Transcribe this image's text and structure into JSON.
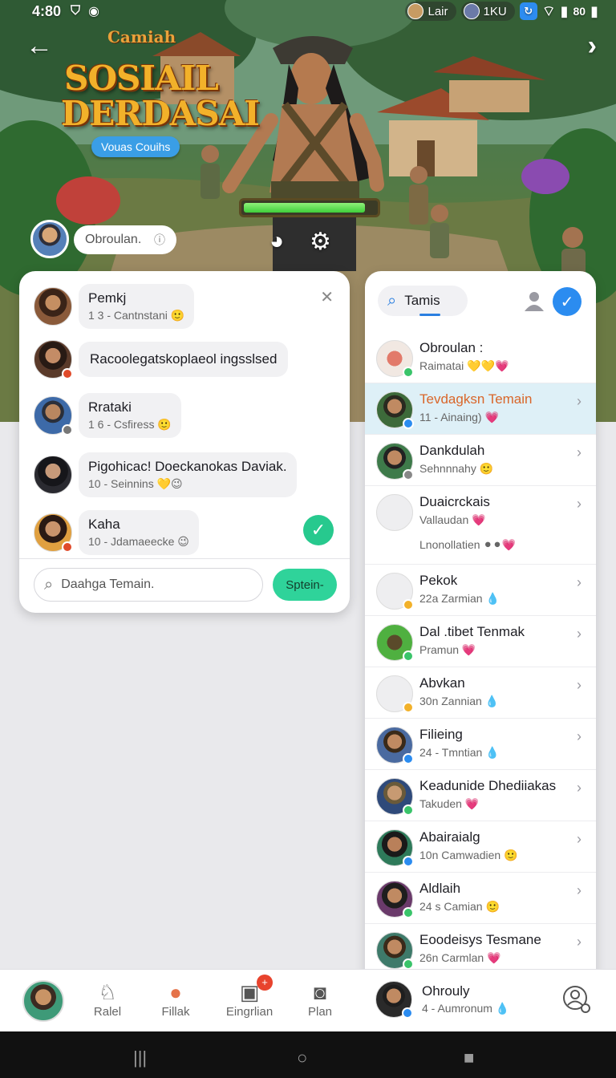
{
  "status_bar": {
    "time": "4:80",
    "chip1": "Lair",
    "chip2": "1KU",
    "battery": "80"
  },
  "game": {
    "subtitle": "Camiah",
    "title": "SOSIAIL DERDASAI",
    "tag": "Vouas Couihs",
    "health_fraction": 0.92
  },
  "profile": {
    "name": "Obroulan."
  },
  "chat_panel": {
    "messages": [
      {
        "name": "Pemkj",
        "sub": "1 3 - Cantnstani 🙂"
      },
      {
        "name": "Racoolegatskoplaeol ingsslsed",
        "sub": ""
      },
      {
        "name": "Rrataki",
        "sub": "1 6 - Csfiress 🙂"
      },
      {
        "name": "Pigohicac! Doeckanokas Daviak.",
        "sub": "10 - Seinnins 💛😉"
      },
      {
        "name": "Kaha",
        "sub": "10 - Jdamaeecke 😉"
      }
    ],
    "search_placeholder": "Daahga Temain.",
    "send_label": "Sptein-"
  },
  "friends_panel": {
    "tab_label": "Tamis",
    "friends": [
      {
        "name": "Obroulan :",
        "sub": "Raimatai 💛💛💗"
      },
      {
        "name": "Tevdagksn Temain",
        "sub": "11 - Ainaing) 💗"
      },
      {
        "name": "Dankdulah",
        "sub": "Sehnnnahy 🙂"
      },
      {
        "name": "Duaicrckais",
        "sub": "Vallaudan 💗",
        "sub2": "Lnonollatien ⚫⚫💗"
      },
      {
        "name": "Pekok",
        "sub": "22a Zarmian 💧"
      },
      {
        "name": "Dal .tibet Tenmak",
        "sub": "Pramun 💗"
      },
      {
        "name": "Abvkan",
        "sub": "30n Zannian 💧"
      },
      {
        "name": "Filieing",
        "sub": "24 - Tmntian 💧"
      },
      {
        "name": "Keadunide Dhediiakas",
        "sub": "Takuden 💗"
      },
      {
        "name": "Abairaialg",
        "sub": "10n Camwadien 🙂"
      },
      {
        "name": "Aldlaih",
        "sub": "24 s Camian 🙂"
      },
      {
        "name": "Eoodeisys Tesmane",
        "sub": "26n Carmlan 💗"
      }
    ]
  },
  "bottom_nav": {
    "items": [
      {
        "label": "Ralel",
        "icon": "bell-icon"
      },
      {
        "label": "Fillak",
        "icon": "balloon-icon"
      },
      {
        "label": "Eingrlian",
        "icon": "inbox-icon",
        "badge": "+"
      },
      {
        "label": "Plan",
        "icon": "camera-icon"
      }
    ],
    "friend": {
      "name": "Ohrouly",
      "sub": "4 - Aumronum 💧"
    }
  },
  "colors": {
    "accent_blue": "#2b8cf0",
    "accent_green": "#2fd39a",
    "active_row": "#def0f7",
    "active_name": "#d9662a"
  }
}
